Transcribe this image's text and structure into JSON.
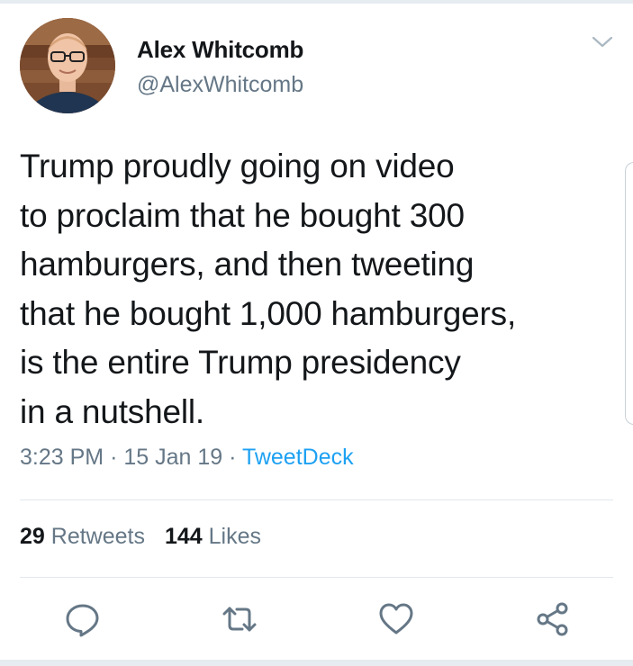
{
  "user": {
    "name": "Alex Whitcomb",
    "handle": "@AlexWhitcomb"
  },
  "tweet": {
    "lines": [
      "Trump proudly going on video",
      "to proclaim that he bought 300",
      "hamburgers, and then tweeting",
      "that he bought 1,000 hamburgers,",
      "is the entire Trump presidency",
      "in a nutshell."
    ],
    "time": "3:23 PM",
    "separator": "·",
    "date": "15 Jan 19",
    "source": "TweetDeck"
  },
  "stats": {
    "retweets_count": "29",
    "retweets_label": "Retweets",
    "likes_count": "144",
    "likes_label": "Likes"
  },
  "icons": {
    "menu": "chevron-down-icon",
    "reply": "reply-icon",
    "retweet": "retweet-icon",
    "like": "heart-icon",
    "share": "share-icon"
  },
  "colors": {
    "text": "#14171a",
    "secondary": "#657786",
    "accent": "#1da1f2",
    "divider": "#e1e8ed"
  }
}
